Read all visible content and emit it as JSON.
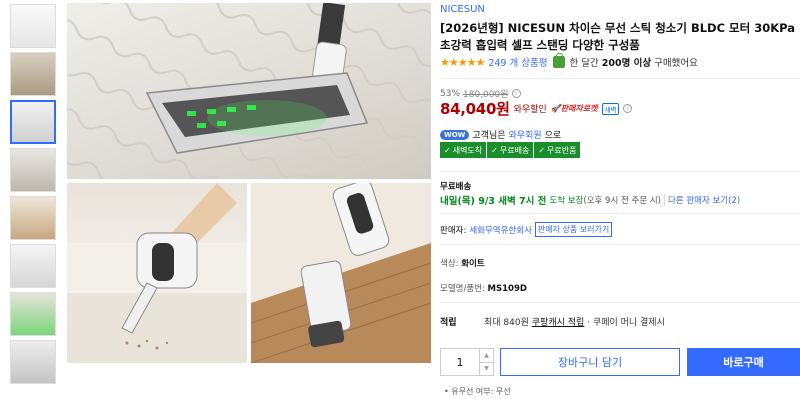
{
  "product": {
    "brand": "NICESUN",
    "title": "[2026년형] NICESUN 차이슨 무선 스틱 청소기 BLDC 모터 30KPa 초강력 흡입력 셀프 스탠딩 다양한 구성품",
    "rating_stars": "★★★★★",
    "review_count": "249 개 상품평",
    "sold_prefix": "한 달간",
    "sold_count": "200명 이상",
    "sold_suffix": "구매했어요"
  },
  "price": {
    "discount_percent": "53%",
    "original_price": "180,000원",
    "sale_price": "84,040원",
    "wow_label": "와우할인",
    "rocket_label": "판매자로켓",
    "new_badge": "새벽"
  },
  "wow": {
    "pill": "WOW",
    "text_prefix": "고객님은",
    "member_link": "와우회원",
    "text_suffix": "으로"
  },
  "benefits": [
    "새벽도착",
    "무료배송",
    "무료반품"
  ],
  "shipping": {
    "title": "무료배송",
    "arrival": "내일(목) 9/3 새벽 7시 전",
    "guarantee": "도착 보장",
    "order_note": "(오후 9시 전 주문 시)",
    "other_sellers": "다른 판매자 보기(2)"
  },
  "seller": {
    "label": "판매자:",
    "name": "세화무역유한회사",
    "products_button": "판매자 상품 보러가기"
  },
  "options": {
    "color_label": "색상:",
    "color_value": "화이트",
    "model_label": "모델명/품번:",
    "model_value": "MS109D"
  },
  "points": {
    "label": "적립",
    "prefix": "최대 840원",
    "cash": "쿠팡캐시 적립",
    "suffix": "· 쿠페이 머니 결제시"
  },
  "purchase": {
    "quantity": "1",
    "cart_button": "장바구니 담기",
    "buy_button": "바로구매"
  },
  "footnote": "• 유무선 여부: 무선",
  "colors": {
    "accent": "#346aff",
    "price_red": "#ae0000",
    "benefit_green": "#1b8e2c",
    "star_orange": "#ff9600"
  }
}
